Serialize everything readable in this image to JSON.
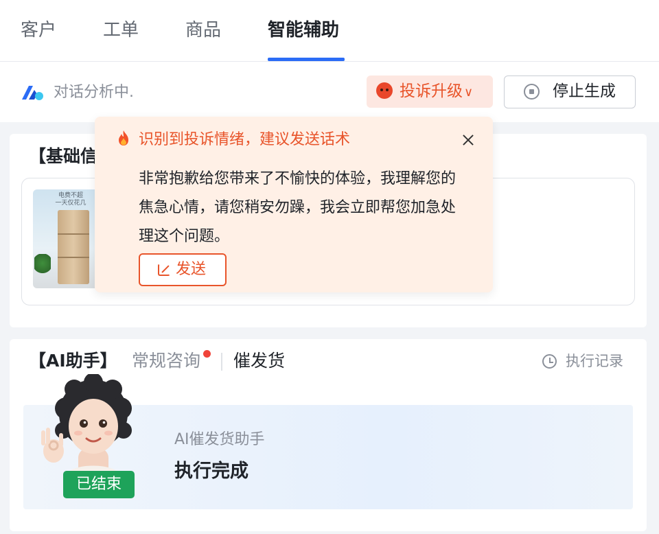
{
  "tabs": [
    {
      "label": "客户"
    },
    {
      "label": "工单"
    },
    {
      "label": "商品"
    },
    {
      "label": "智能辅助"
    }
  ],
  "status": {
    "text": "对话分析中.",
    "complaint_label": "投诉升级",
    "stop_label": "停止生成"
  },
  "basic_card": {
    "title": "【基础信",
    "product_caption_1": "电费不超",
    "product_caption_2": "一天仅花几"
  },
  "popup": {
    "title": "识别到投诉情绪，建议发送话术",
    "body": "非常抱歉给您带来了不愉快的体验，我理解您的焦急心情，请您稍安勿躁，我会立即帮您加急处理这个问题。",
    "send_label": "发送"
  },
  "ai_card": {
    "title": "【AI助手】",
    "tab_regular": "常规咨询",
    "tab_urge": "催发货",
    "history_label": "执行记录",
    "status_badge": "已结束",
    "assistant_name": "AI催发货助手",
    "result": "执行完成"
  },
  "colors": {
    "accent_blue": "#2b6cf6",
    "complaint_orange": "#e8542a",
    "success_green": "#1ea35a"
  }
}
